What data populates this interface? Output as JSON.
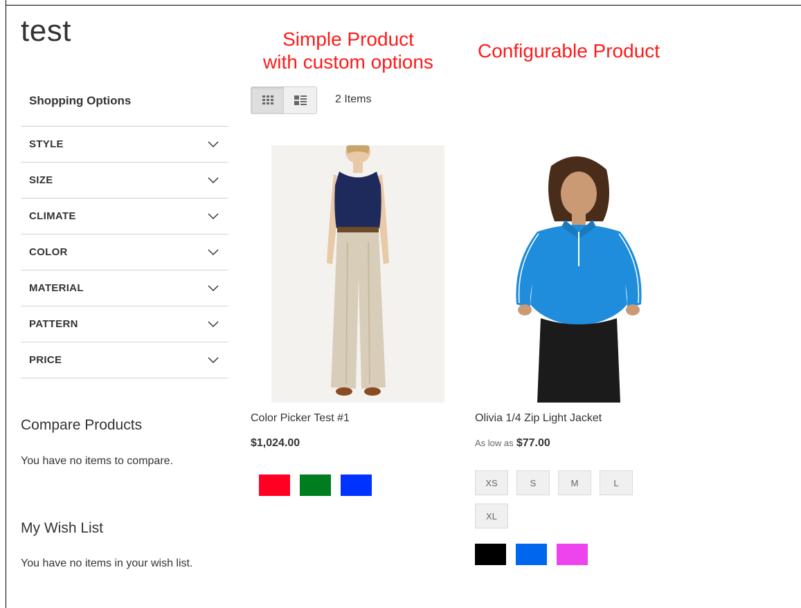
{
  "page": {
    "title": "test"
  },
  "annotations": {
    "simple_line1": "Simple Product",
    "simple_line2": "with custom options",
    "configurable": "Configurable Product"
  },
  "sidebar": {
    "title": "Shopping Options",
    "filters": [
      {
        "label": "STYLE"
      },
      {
        "label": "SIZE"
      },
      {
        "label": "CLIMATE"
      },
      {
        "label": "COLOR"
      },
      {
        "label": "MATERIAL"
      },
      {
        "label": "PATTERN"
      },
      {
        "label": "PRICE"
      }
    ],
    "compare": {
      "title": "Compare Products",
      "empty_text": "You have no items to compare."
    },
    "wishlist": {
      "title": "My Wish List",
      "empty_text": "You have no items in your wish list."
    }
  },
  "toolbar": {
    "view_modes": [
      {
        "icon": "grid-icon",
        "active": true
      },
      {
        "icon": "list-icon",
        "active": false
      }
    ],
    "amount": "2 Items"
  },
  "products": [
    {
      "name": "Color Picker Test #1",
      "price": "$1,024.00",
      "price_prefix": "",
      "sizes": [],
      "colors": [
        "#ff0022",
        "#007d1f",
        "#0033ff"
      ]
    },
    {
      "name": "Olivia 1/4 Zip Light Jacket",
      "price": "$77.00",
      "price_prefix": "As low as",
      "sizes": [
        "XS",
        "S",
        "M",
        "L",
        "XL"
      ],
      "colors": [
        "#000000",
        "#0066ee",
        "#ee44ee"
      ]
    }
  ]
}
